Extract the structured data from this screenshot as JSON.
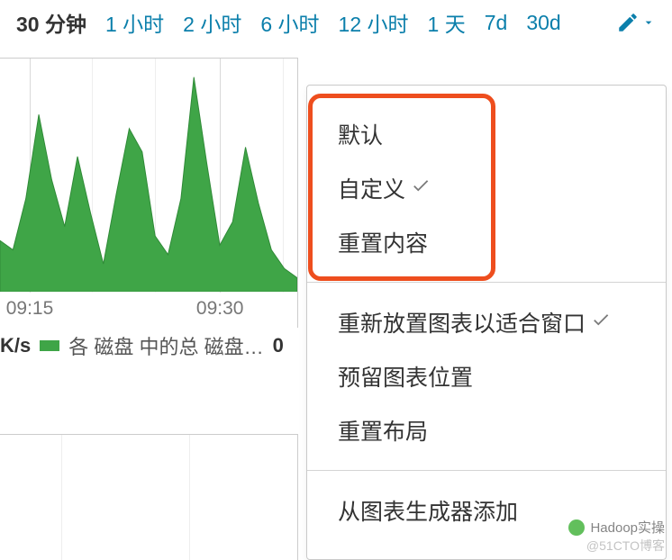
{
  "time_ranges": [
    {
      "label": "30 分钟",
      "active": true
    },
    {
      "label": "1 小时",
      "active": false
    },
    {
      "label": "2 小时",
      "active": false
    },
    {
      "label": "6 小时",
      "active": false
    },
    {
      "label": "12 小时",
      "active": false
    },
    {
      "label": "1 天",
      "active": false
    },
    {
      "label": "7d",
      "active": false
    },
    {
      "label": "30d",
      "active": false
    }
  ],
  "dropdown": {
    "group1": [
      {
        "label": "默认",
        "checked": false
      },
      {
        "label": "自定义",
        "checked": true
      },
      {
        "label": "重置内容",
        "checked": false
      }
    ],
    "group2": [
      {
        "label": "重新放置图表以适合窗口",
        "checked": true
      },
      {
        "label": "预留图表位置",
        "checked": false
      },
      {
        "label": "重置布局",
        "checked": false
      }
    ],
    "group3": [
      {
        "label": "从图表生成器添加",
        "checked": false
      }
    ]
  },
  "chart_data": {
    "type": "area",
    "x_span_minutes": 30,
    "x_ticks": [
      "09:15",
      "09:30"
    ],
    "x_tick_positions_pct": [
      10,
      74
    ],
    "major_gridlines_pct": [
      10,
      74
    ],
    "minor_gridlines_pct": [
      31,
      52,
      95
    ],
    "fill_color": "#3fa547",
    "series": [
      {
        "name": "各 磁盘 中的总 磁盘…",
        "unit": "K/s",
        "last_value": 0,
        "values_norm": [
          0.22,
          0.18,
          0.4,
          0.76,
          0.48,
          0.28,
          0.58,
          0.34,
          0.12,
          0.42,
          0.7,
          0.6,
          0.24,
          0.16,
          0.4,
          0.92,
          0.55,
          0.2,
          0.3,
          0.62,
          0.38,
          0.18,
          0.1,
          0.06
        ]
      }
    ]
  },
  "legend": {
    "unit": "K/s",
    "label": "各 磁盘 中的总 磁盘…",
    "value": "0"
  },
  "watermark": {
    "line1": "Hadoop实操",
    "line2": "@51CTO博客"
  }
}
